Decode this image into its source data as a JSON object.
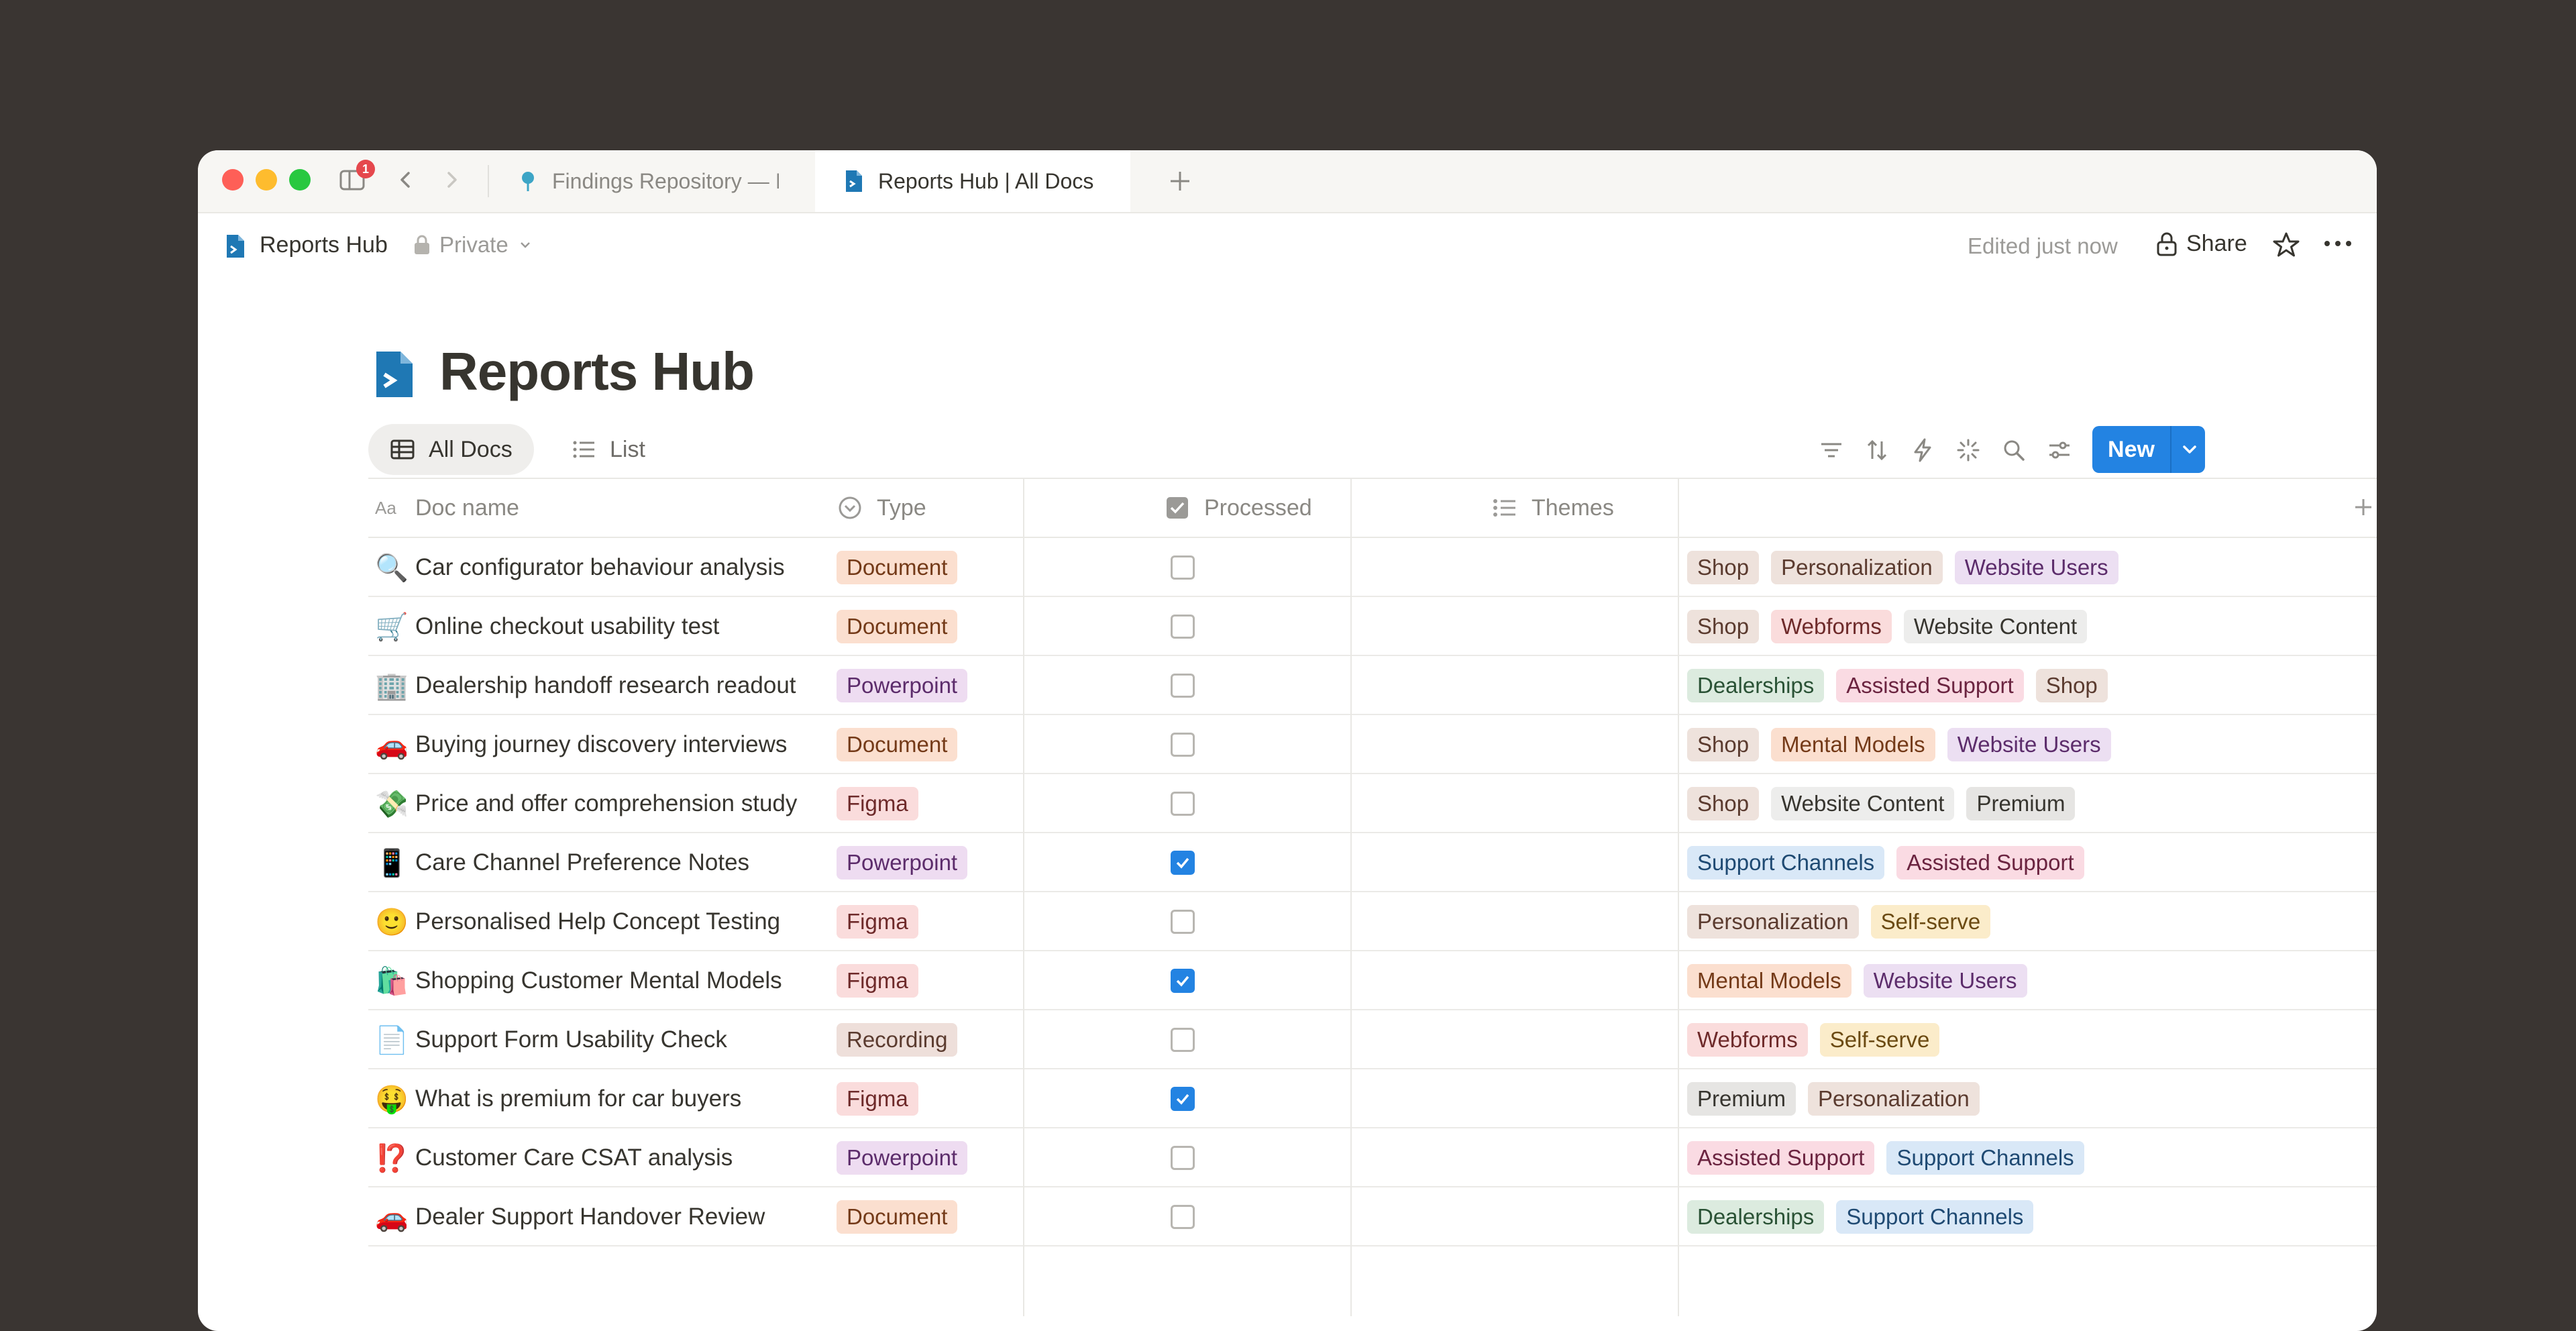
{
  "browser": {
    "notification_count": "1",
    "tabs": [
      {
        "label": "Findings Repository — I",
        "icon": "pin-icon",
        "active": false
      },
      {
        "label": "Reports Hub | All Docs",
        "icon": "doc-icon",
        "active": true
      }
    ]
  },
  "header": {
    "breadcrumb_title": "Reports Hub",
    "privacy": "Private",
    "edited": "Edited just now",
    "share_label": "Share"
  },
  "page": {
    "title": "Reports Hub"
  },
  "views": {
    "tabs": [
      {
        "label": "All Docs",
        "icon": "table-icon",
        "active": true
      },
      {
        "label": "List",
        "icon": "list-icon",
        "active": false
      }
    ],
    "new_button": "New"
  },
  "table": {
    "columns": [
      {
        "label": "Doc name",
        "icon": "text-property-icon"
      },
      {
        "label": "Type",
        "icon": "select-property-icon"
      },
      {
        "label": "Processed",
        "icon": "checkbox-property-icon"
      },
      {
        "label": "Themes",
        "icon": "multiselect-property-icon"
      }
    ],
    "rows": [
      {
        "emoji": "🔍",
        "name": "Car configurator behaviour analysis",
        "type": "Document",
        "processed": false,
        "themes": [
          "Shop",
          "Personalization",
          "Website Users"
        ]
      },
      {
        "emoji": "🛒",
        "name": "Online checkout usability test",
        "type": "Document",
        "processed": false,
        "themes": [
          "Shop",
          "Webforms",
          "Website Content"
        ]
      },
      {
        "emoji": "🏢",
        "name": "Dealership handoff research readout",
        "type": "Powerpoint",
        "processed": false,
        "themes": [
          "Dealerships",
          "Assisted Support",
          "Shop"
        ]
      },
      {
        "emoji": "🚗",
        "name": "Buying journey discovery interviews",
        "type": "Document",
        "processed": false,
        "themes": [
          "Shop",
          "Mental Models",
          "Website Users"
        ]
      },
      {
        "emoji": "💸",
        "name": "Price and offer comprehension study",
        "type": "Figma",
        "processed": false,
        "themes": [
          "Shop",
          "Website Content",
          "Premium"
        ]
      },
      {
        "emoji": "📱",
        "name": "Care Channel Preference Notes",
        "type": "Powerpoint",
        "processed": true,
        "themes": [
          "Support Channels",
          "Assisted Support"
        ]
      },
      {
        "emoji": "🙂",
        "name": "Personalised Help Concept Testing",
        "type": "Figma",
        "processed": false,
        "themes": [
          "Personalization",
          "Self-serve"
        ]
      },
      {
        "emoji": "🛍️",
        "name": "Shopping Customer Mental Models",
        "type": "Figma",
        "processed": true,
        "themes": [
          "Mental Models",
          "Website Users"
        ]
      },
      {
        "emoji": "📄",
        "name": "Support Form Usability Check",
        "type": "Recording",
        "processed": false,
        "themes": [
          "Webforms",
          "Self-serve"
        ]
      },
      {
        "emoji": "🤑",
        "name": "What is premium for car buyers",
        "type": "Figma",
        "processed": true,
        "themes": [
          "Premium",
          "Personalization"
        ]
      },
      {
        "emoji": "⁉️",
        "name": "Customer Care CSAT analysis",
        "type": "Powerpoint",
        "processed": false,
        "themes": [
          "Assisted Support",
          "Support Channels"
        ]
      },
      {
        "emoji": "🚗",
        "name": "Dealer Support Handover Review",
        "type": "Document",
        "processed": false,
        "themes": [
          "Dealerships",
          "Support Channels"
        ]
      }
    ]
  },
  "tag_colors": {
    "Document": {
      "bg": "#fbdfcf",
      "fg": "#743a18"
    },
    "Powerpoint": {
      "bg": "#eedcf1",
      "fg": "#5c2c6b"
    },
    "Figma": {
      "bg": "#fadcdc",
      "fg": "#6e2a2a"
    },
    "Recording": {
      "bg": "#eedfda",
      "fg": "#5b3b2f"
    },
    "Shop": {
      "bg": "#eee2dc",
      "fg": "#5b3b2f"
    },
    "Personalization": {
      "bg": "#eee2dc",
      "fg": "#5b3b2f"
    },
    "Website Users": {
      "bg": "#ecdff2",
      "fg": "#5c2c6b"
    },
    "Webforms": {
      "bg": "#fadcdc",
      "fg": "#6e2a2a"
    },
    "Website Content": {
      "bg": "#ededec",
      "fg": "#37352f"
    },
    "Dealerships": {
      "bg": "#dcebdf",
      "fg": "#2a5235"
    },
    "Assisted Support": {
      "bg": "#fadbe3",
      "fg": "#6b2440"
    },
    "Mental Models": {
      "bg": "#fbdfcf",
      "fg": "#743a18"
    },
    "Premium": {
      "bg": "#e6e5e3",
      "fg": "#37352f"
    },
    "Support Channels": {
      "bg": "#d9e8f7",
      "fg": "#1f4a73"
    },
    "Self-serve": {
      "bg": "#fbecca",
      "fg": "#6b4a12"
    }
  },
  "accent_color": "#2383e2"
}
